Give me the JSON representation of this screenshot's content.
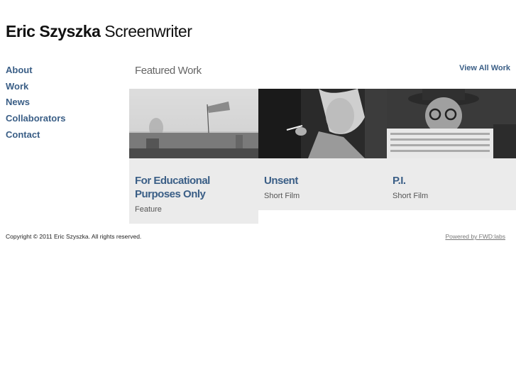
{
  "header": {
    "name": "Eric Szyszka",
    "role": "Screenwriter"
  },
  "nav": {
    "items": [
      {
        "label": "About"
      },
      {
        "label": "Work"
      },
      {
        "label": "News"
      },
      {
        "label": "Collaborators"
      },
      {
        "label": "Contact"
      }
    ]
  },
  "featured": {
    "heading": "Featured Work",
    "view_all_label": "View All Work",
    "works": [
      {
        "title": "For Educational Purposes Only",
        "type": "Feature"
      },
      {
        "title": "Unsent",
        "type": "Short Film"
      },
      {
        "title": "P.I.",
        "type": "Short Film"
      }
    ]
  },
  "footer": {
    "copyright": "Copyright © 2011 Eric Szyszka. All rights reserved.",
    "powered_by": "Powered by FWD:labs"
  },
  "colors": {
    "link": "#3a5e86",
    "card_bg": "#ebebeb",
    "heading_gray": "#666666"
  }
}
